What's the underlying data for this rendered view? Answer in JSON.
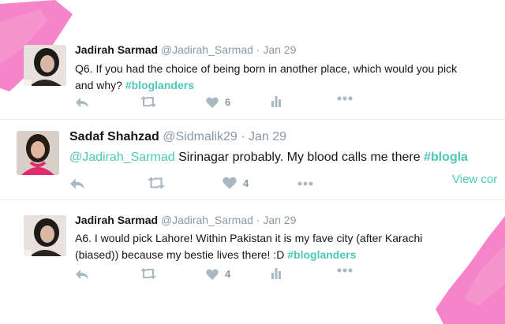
{
  "tweets": [
    {
      "name": "Jadirah Sarmad",
      "handle": "@Jadirah_Sarmad",
      "dot": "·",
      "date": "Jan 29",
      "text_line1": "Q6. If you had the choice of being born in another place, which would you pick",
      "text_line2": "and why? ",
      "hashtag": "#bloglanders",
      "likes": "6"
    },
    {
      "name": "Sadaf Shahzad",
      "handle": "@Sidmalik29",
      "dot": "·",
      "date": "Jan 29",
      "mention": "@Jadirah_Sarmad",
      "text": " Sirinagar probably. My blood calls me there ",
      "hashtag": "#blogla",
      "likes": "4",
      "view_link": "View cor"
    },
    {
      "name": "Jadirah Sarmad",
      "handle": "@Jadirah_Sarmad",
      "dot": "·",
      "date": "Jan 29",
      "text_line1": "A6. I would pick Lahore! Within Pakistan it is my fave city (after Karachi",
      "text_line2": "(biased)) because my bestie lives there! :D ",
      "hashtag": "#bloglanders",
      "likes": "4"
    }
  ],
  "icons": {
    "reply": "reply-icon",
    "retweet": "retweet-icon",
    "like": "heart-icon",
    "analytics": "analytics-icon",
    "more": "more-icon"
  },
  "colors": {
    "accent": "#4ec8b6",
    "brush": "#f47ac3",
    "icon": "#aab8c2",
    "muted": "#8899a6"
  }
}
